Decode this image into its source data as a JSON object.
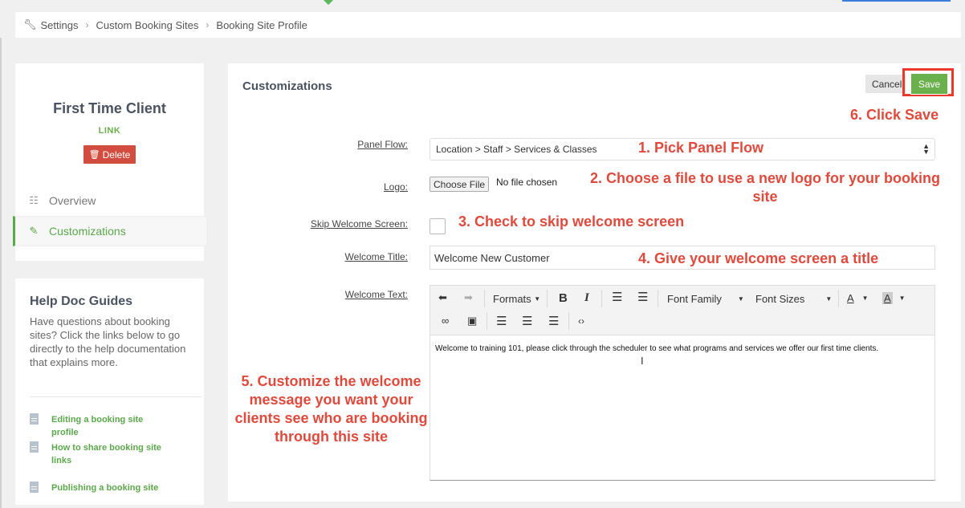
{
  "breadcrumb": {
    "items": [
      "Settings",
      "Custom Booking Sites",
      "Booking Site Profile"
    ]
  },
  "profile": {
    "title": "First Time Client",
    "link_label": "LINK",
    "delete_label": "Delete"
  },
  "nav": {
    "overview": "Overview",
    "customizations": "Customizations"
  },
  "help": {
    "title": "Help Doc Guides",
    "description": "Have questions about booking sites? Click the links below to go directly to the help documentation that explains more.",
    "links": [
      "Editing a booking site profile",
      "How to share booking site links",
      "Publishing a booking site"
    ]
  },
  "main": {
    "title": "Customizations",
    "cancel_label": "Cancel",
    "save_label": "Save",
    "fields": {
      "panel_flow_label": "Panel Flow:",
      "panel_flow_value": "Location > Staff > Services & Classes",
      "logo_label": "Logo:",
      "choose_file_label": "Choose File",
      "no_file_text": "No file chosen",
      "skip_welcome_label": "Skip Welcome Screen:",
      "skip_welcome_checked": false,
      "welcome_title_label": "Welcome Title:",
      "welcome_title_value": "Welcome New Customer",
      "welcome_text_label": "Welcome Text:",
      "welcome_text_value": "Welcome to training 101, please click through the scheduler to see what programs and services we offer our first time clients."
    },
    "toolbar": {
      "formats": "Formats",
      "bold": "B",
      "italic": "I",
      "font_family": "Font Family",
      "font_sizes": "Font Sizes",
      "text_color": "A",
      "bg_color": "A"
    }
  },
  "annotations": {
    "a1": "1. Pick Panel Flow",
    "a2": "2. Choose a file to use a new logo for your booking site",
    "a3": "3. Check to skip welcome screen",
    "a4": "4. Give your welcome screen a title",
    "a5": "5. Customize the welcome message you want your clients see who are booking through this site",
    "a6": "6. Click Save"
  },
  "colors": {
    "accent_green": "#6ab04c",
    "delete_red": "#d24d3f",
    "annotation_red": "#e04a3c"
  }
}
